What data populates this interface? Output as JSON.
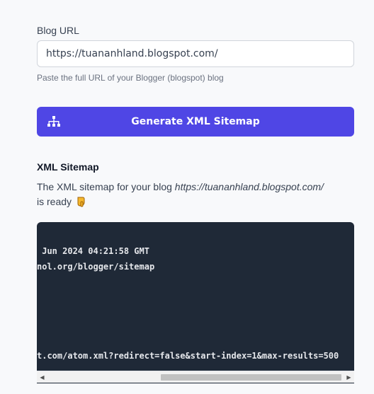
{
  "form": {
    "url_label": "Blog URL",
    "url_value": "https://tuananhland.blogspot.com/",
    "hint": "Paste the full URL of your Blogger (blogspot) blog",
    "generate_button": "Generate XML Sitemap",
    "generate_icon": "sitemap-icon"
  },
  "result": {
    "title": "XML Sitemap",
    "desc_prefix": "The XML sitemap for your blog ",
    "desc_url": "https://tuananhland.blogspot.com/",
    "desc_suffix": " is ready",
    "desc_icon": "pointing-hand-icon"
  },
  "code": {
    "lines": [
      " Jun 2024 04:21:58 GMT",
      "nol.org/blogger/sitemap",
      "t.com/atom.xml?redirect=false&start-index=1&max-results=500"
    ]
  },
  "scrollbar": {
    "left_arrow": "◀",
    "right_arrow": "▶"
  }
}
